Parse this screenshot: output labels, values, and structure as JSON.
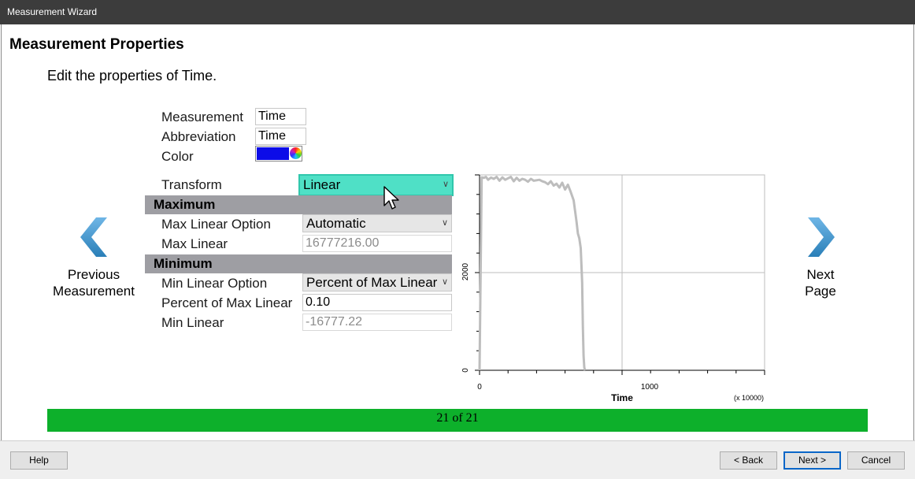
{
  "window": {
    "title": "Measurement Wizard"
  },
  "page": {
    "title": "Measurement Properties",
    "subtitle": "Edit the properties of Time."
  },
  "form": {
    "measurement": {
      "label": "Measurement",
      "value": "Time"
    },
    "abbreviation": {
      "label": "Abbreviation",
      "value": "Time"
    },
    "color": {
      "label": "Color",
      "swatch": "#0c0ce8"
    },
    "transform": {
      "label": "Transform",
      "value": "Linear"
    },
    "maximum_section": "Maximum",
    "max_linear_option": {
      "label": "Max Linear Option",
      "value": "Automatic"
    },
    "max_linear": {
      "label": "Max Linear",
      "value": "16777216.00"
    },
    "minimum_section": "Minimum",
    "min_linear_option": {
      "label": "Min Linear Option",
      "value": "Percent of Max Linear"
    },
    "percent_of_max_linear": {
      "label": "Percent of Max Linear",
      "value": "0.10"
    },
    "min_linear": {
      "label": "Min Linear",
      "value": "-16777.22"
    }
  },
  "nav": {
    "previous_line1": "Previous",
    "previous_line2": "Measurement",
    "next_line1": "Next",
    "next_line2": "Page"
  },
  "progress": {
    "label": "21 of 21",
    "value": 1.0,
    "color": "#0db02b"
  },
  "footer": {
    "help": "Help",
    "back": "< Back",
    "next": "Next >",
    "cancel": "Cancel"
  },
  "chart_data": {
    "type": "line",
    "xlabel": "Time",
    "x_multiplier_label": "(x 10000)",
    "x_ticks": [
      "0",
      "1000"
    ],
    "y_ticks": [
      "0",
      "2000"
    ],
    "xlim": [
      0,
      2000
    ],
    "ylim": [
      0,
      4000
    ],
    "grid": true,
    "series": [
      {
        "color": "#bdbdbd",
        "x": [
          0,
          15,
          30,
          45,
          60,
          80,
          100,
          120,
          140,
          160,
          180,
          200,
          220,
          240,
          260,
          280,
          300,
          320,
          340,
          360,
          380,
          400,
          420,
          440,
          460,
          480,
          500,
          520,
          540,
          560,
          580,
          600,
          620,
          640,
          660,
          680,
          690,
          700,
          710,
          720,
          725,
          730,
          735,
          740
        ],
        "y": [
          0,
          3950,
          3940,
          3960,
          3900,
          3945,
          3920,
          3960,
          3880,
          3950,
          3900,
          3930,
          3960,
          3870,
          3940,
          3880,
          3920,
          3900,
          3860,
          3920,
          3880,
          3890,
          3900,
          3870,
          3850,
          3810,
          3870,
          3780,
          3820,
          3740,
          3840,
          3700,
          3800,
          3650,
          3480,
          3050,
          2800,
          2700,
          2500,
          1800,
          900,
          300,
          60,
          0
        ]
      }
    ]
  }
}
